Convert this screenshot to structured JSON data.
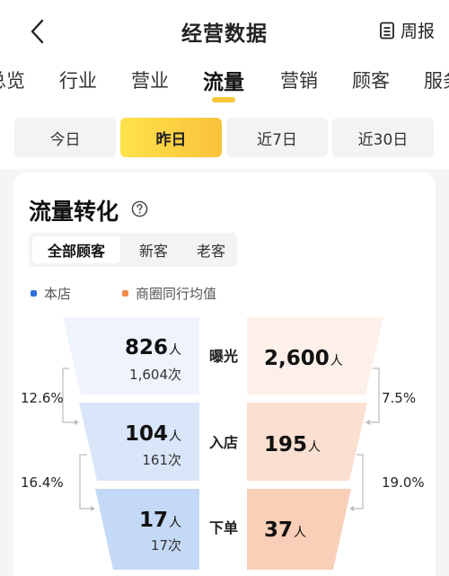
{
  "header": {
    "title": "经营数据",
    "weekly_label": "周报"
  },
  "tabs": [
    "总览",
    "行业",
    "营业",
    "流量",
    "营销",
    "顾客",
    "服务"
  ],
  "periods": [
    "今日",
    "昨日",
    "近7日",
    "近30日"
  ],
  "active_period": "昨日",
  "card": {
    "title": "流量转化",
    "segments": [
      "全部顾客",
      "新客",
      "老客"
    ],
    "legend": {
      "store": "本店",
      "district": "商圈同行均值"
    },
    "colors": {
      "store": "#2f6fdc",
      "district": "#f08a4b"
    },
    "stages": [
      {
        "label": "曝光",
        "store_value": "826",
        "store_unit": "人",
        "store_sub": "1,604次",
        "district_value": "2,600",
        "district_unit": "人"
      },
      {
        "label": "入店",
        "store_value": "104",
        "store_unit": "人",
        "store_sub": "161次",
        "district_value": "195",
        "district_unit": "人"
      },
      {
        "label": "下单",
        "store_value": "17",
        "store_unit": "人",
        "store_sub": "17次",
        "district_value": "37",
        "district_unit": "人"
      }
    ],
    "store_rates": [
      "12.6%",
      "16.4%"
    ],
    "district_rates": [
      "7.5%",
      "19.0%"
    ]
  }
}
